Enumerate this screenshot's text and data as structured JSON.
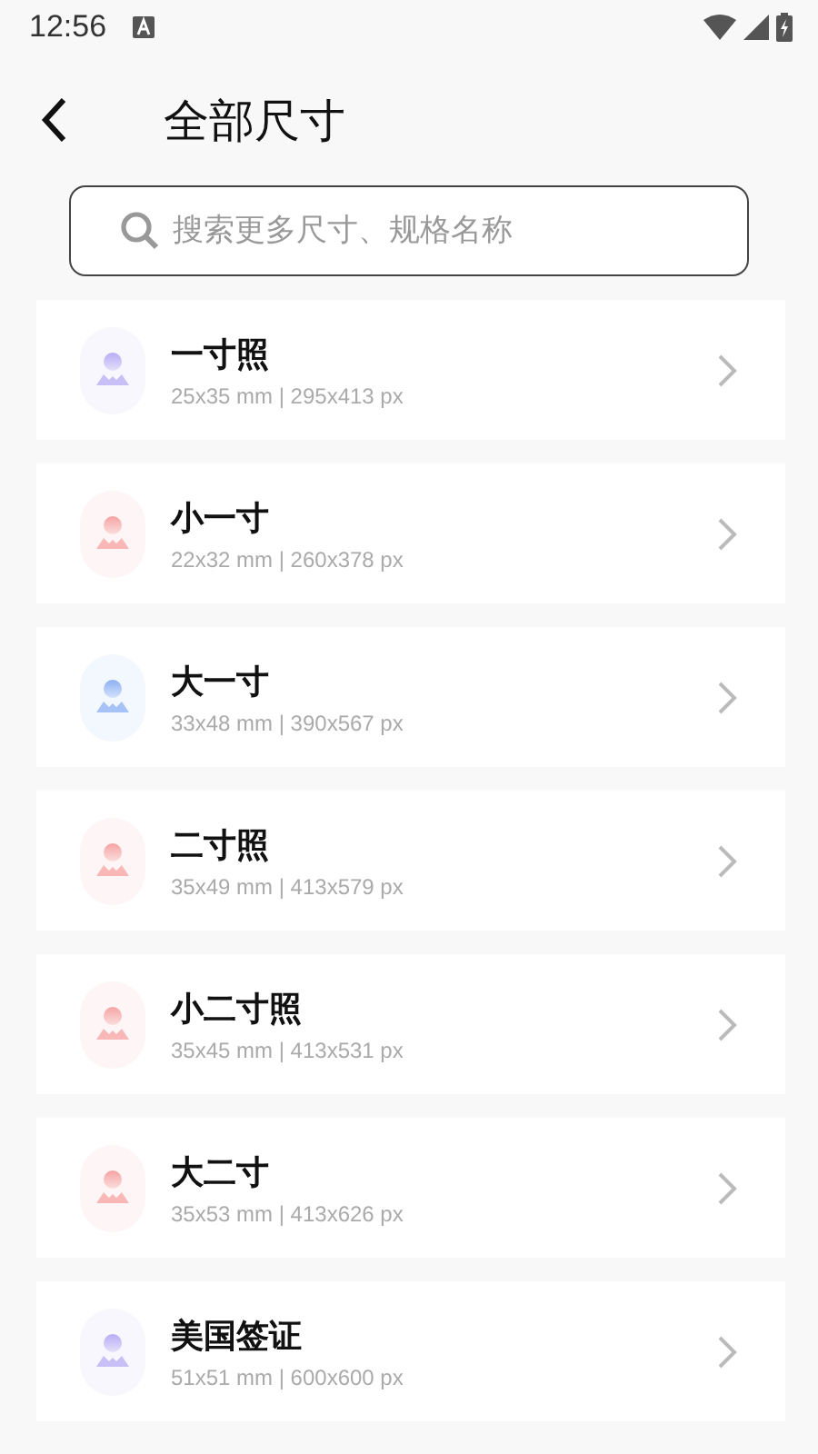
{
  "status_bar": {
    "time": "12:56"
  },
  "header": {
    "title": "全部尺寸"
  },
  "search": {
    "placeholder": "搜索更多尺寸、规格名称"
  },
  "sizes": [
    {
      "name": "一寸照",
      "spec": "25x35 mm | 295x413 px",
      "color": "#b8acf4"
    },
    {
      "name": "小一寸",
      "spec": "22x32 mm | 260x378 px",
      "color": "#f6a3a3"
    },
    {
      "name": "大一寸",
      "spec": "33x48 mm | 390x567 px",
      "color": "#8cb0f3"
    },
    {
      "name": "二寸照",
      "spec": "35x49 mm | 413x579 px",
      "color": "#f6a3a3"
    },
    {
      "name": "小二寸照",
      "spec": "35x45 mm | 413x531 px",
      "color": "#f6a3a3"
    },
    {
      "name": "大二寸",
      "spec": "35x53 mm | 413x626 px",
      "color": "#f6a3a3"
    },
    {
      "name": "美国签证",
      "spec": "51x51 mm | 600x600 px",
      "color": "#b8acf4"
    }
  ]
}
